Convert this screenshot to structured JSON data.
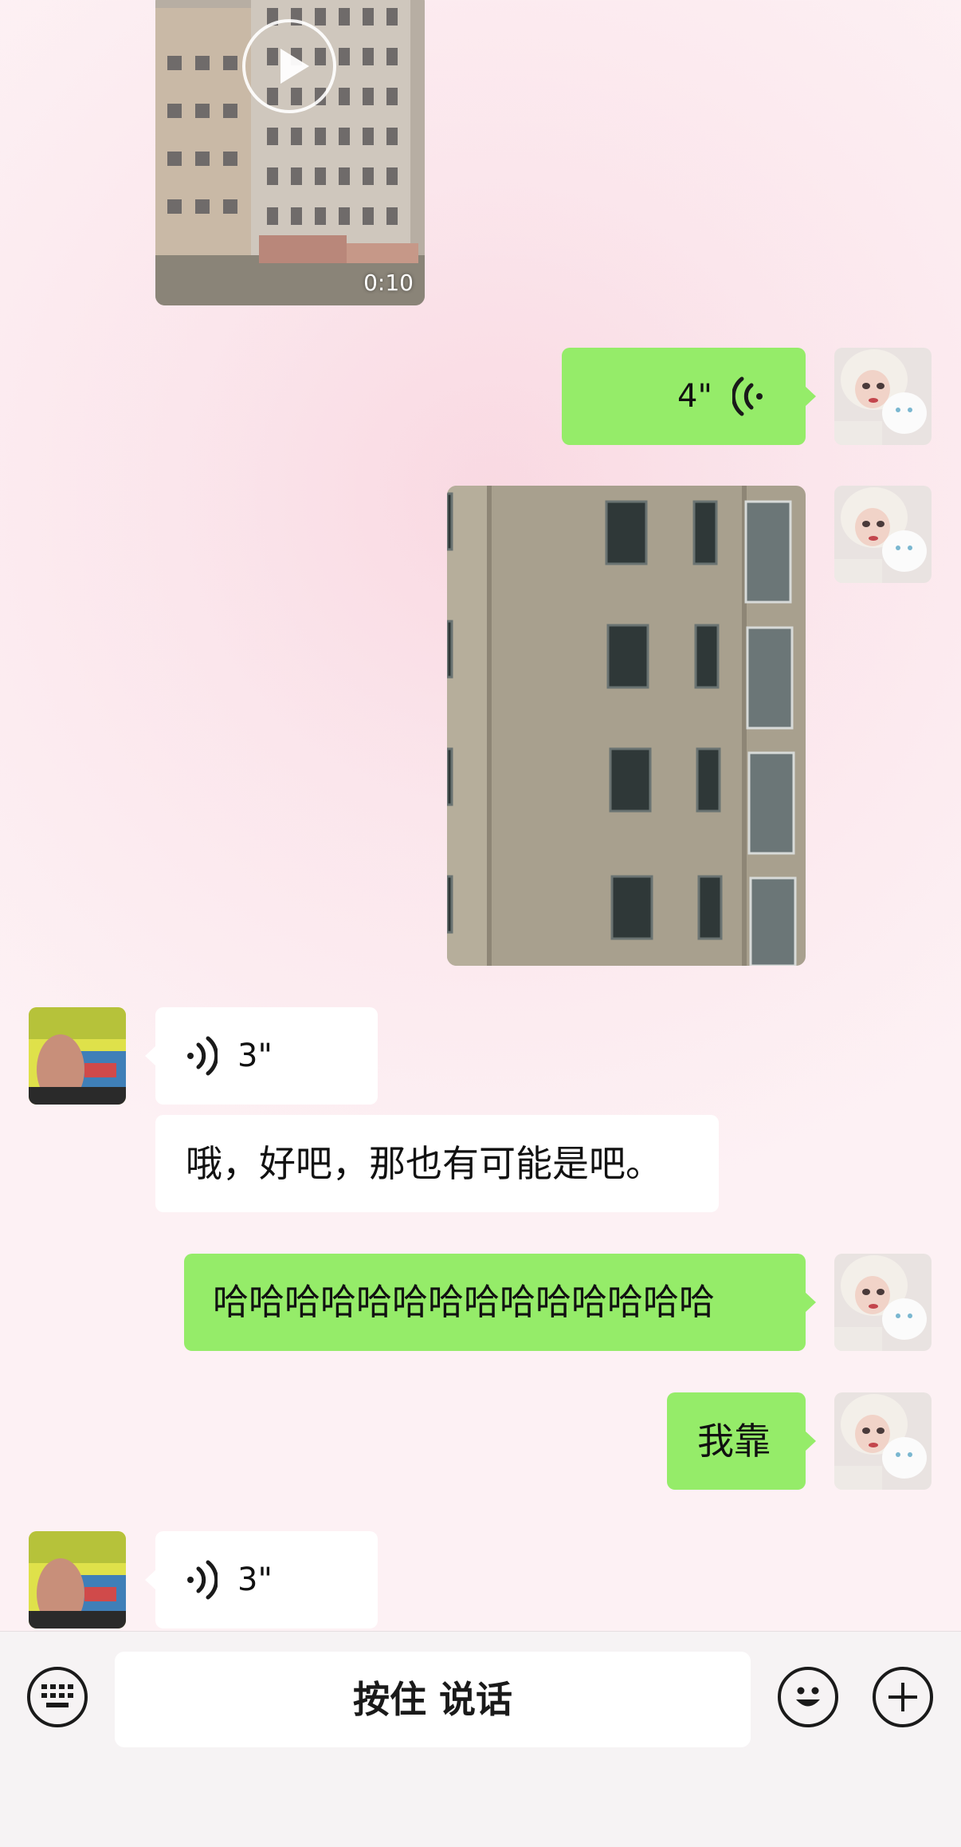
{
  "messages": {
    "video": {
      "duration": "0:10"
    },
    "voice_sent": {
      "duration": "4\""
    },
    "voice_recv_1": {
      "duration": "3\""
    },
    "text_recv_1": {
      "text": "哦，好吧，那也有可能是吧。"
    },
    "text_sent_1": {
      "text": "哈哈哈哈哈哈哈哈哈哈哈哈哈哈"
    },
    "text_sent_2": {
      "text": "我靠"
    },
    "voice_recv_2": {
      "duration": "3\""
    }
  },
  "input_bar": {
    "hold_to_talk_label": "按住 说话",
    "icons": [
      "keyboard-icon",
      "emoji-icon",
      "plus-icon"
    ]
  },
  "colors": {
    "sent_bubble": "#95ec69",
    "received_bubble": "#ffffff",
    "background": "#fbe6ec"
  }
}
